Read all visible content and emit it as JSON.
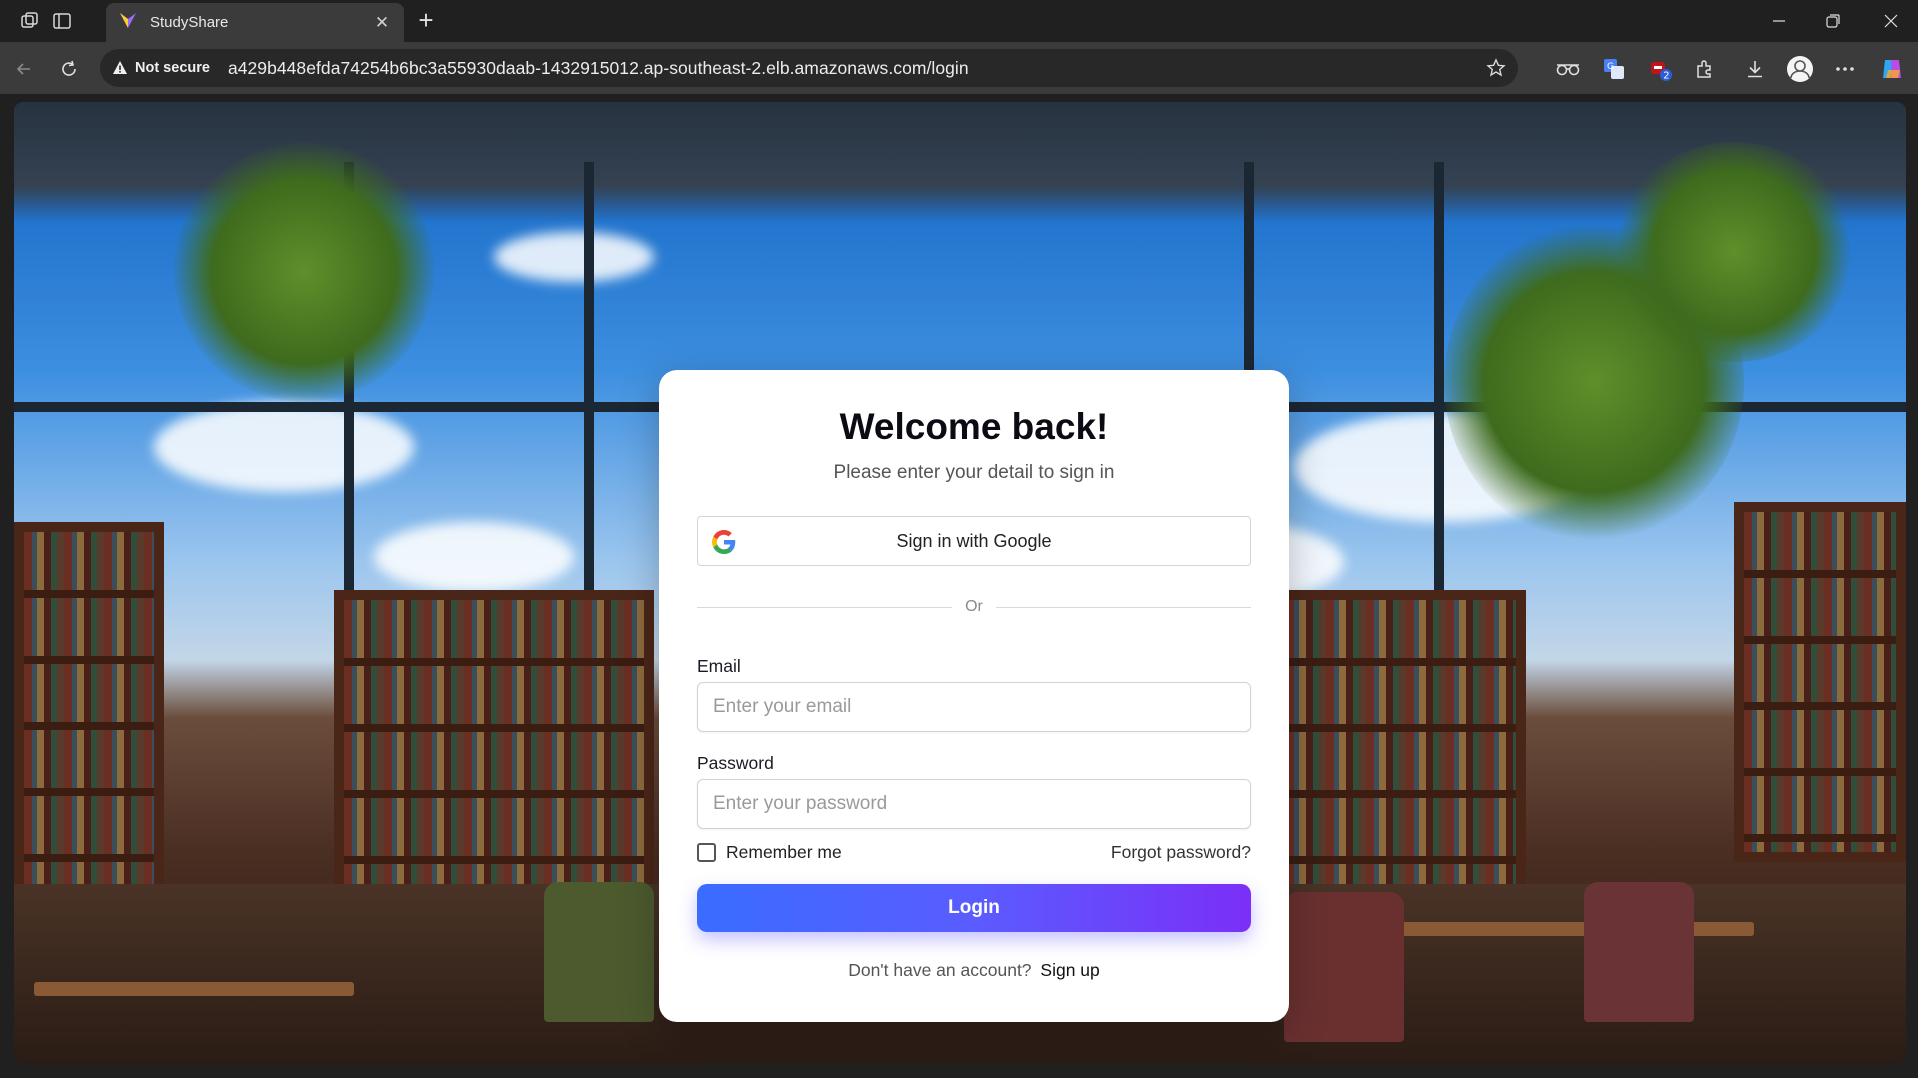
{
  "browser": {
    "tab_title": "StudyShare",
    "security_label": "Not secure",
    "url": "a429b448efda74254b6bc3a55930daab-1432915012.ap-southeast-2.elb.amazonaws.com/login",
    "extension_badge": "2"
  },
  "login": {
    "title": "Welcome back!",
    "subtitle": "Please enter your detail to sign in",
    "google_button": "Sign in with Google",
    "divider_text": "Or",
    "email_label": "Email",
    "email_placeholder": "Enter your email",
    "password_label": "Password",
    "password_placeholder": "Enter your password",
    "remember_label": "Remember me",
    "forgot_link": "Forgot password?",
    "login_button": "Login",
    "signup_prompt": "Don't have an account?",
    "signup_link": "Sign up"
  },
  "colors": {
    "button_gradient_start": "#3a6cff",
    "button_gradient_end": "#7b2ff7",
    "card_bg": "#ffffff"
  },
  "icons": [
    "workspaces-icon",
    "tab-actions-icon",
    "studyshare-logo-icon",
    "close-tab-icon",
    "new-tab-icon",
    "minimize-icon",
    "restore-icon",
    "close-window-icon",
    "back-icon",
    "reload-icon",
    "warning-icon",
    "favorite-star-icon",
    "reading-glasses-icon",
    "translate-icon",
    "extension-badge-icon",
    "extensions-icon",
    "downloads-icon",
    "profile-icon",
    "more-icon",
    "copilot-icon",
    "google-icon"
  ]
}
